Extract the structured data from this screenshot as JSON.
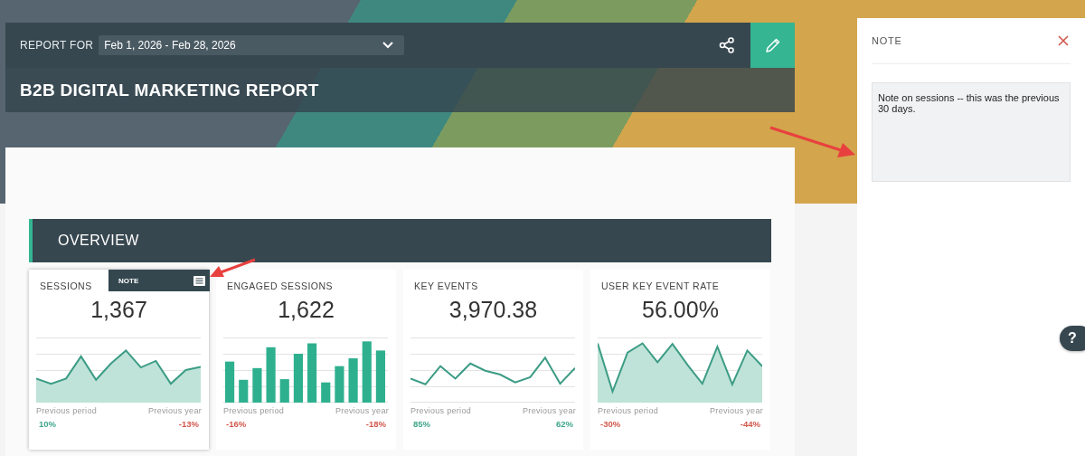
{
  "header": {
    "report_for_label": "REPORT FOR",
    "date_range": "Feb 1, 2026 - Feb 28, 2026",
    "title": "B2B DIGITAL MARKETING REPORT"
  },
  "section": {
    "title": "OVERVIEW"
  },
  "cards": [
    {
      "title": "SESSIONS",
      "value": "1,367",
      "kind": "area",
      "selected": true,
      "note": {
        "label": "NOTE"
      },
      "previous_period": {
        "label": "Previous period",
        "value": "10%",
        "positive": true
      },
      "previous_year": {
        "label": "Previous year",
        "value": "-13%",
        "positive": false
      }
    },
    {
      "title": "ENGAGED SESSIONS",
      "value": "1,622",
      "kind": "bar",
      "selected": false,
      "previous_period": {
        "label": "Previous period",
        "value": "-16%",
        "positive": false
      },
      "previous_year": {
        "label": "Previous year",
        "value": "-18%",
        "positive": false
      }
    },
    {
      "title": "KEY EVENTS",
      "value": "3,970.38",
      "kind": "line",
      "selected": false,
      "previous_period": {
        "label": "Previous period",
        "value": "85%",
        "positive": true
      },
      "previous_year": {
        "label": "Previous year",
        "value": "62%",
        "positive": true
      }
    },
    {
      "title": "USER KEY EVENT RATE",
      "value": "56.00%",
      "kind": "area",
      "selected": false,
      "previous_period": {
        "label": "Previous period",
        "value": "-30%",
        "positive": false
      },
      "previous_year": {
        "label": "Previous year",
        "value": "-44%",
        "positive": false
      }
    }
  ],
  "note_panel": {
    "title": "NOTE",
    "text": "Note on sessions -- this was the previous 30 days."
  },
  "help": {
    "label": "?"
  }
}
